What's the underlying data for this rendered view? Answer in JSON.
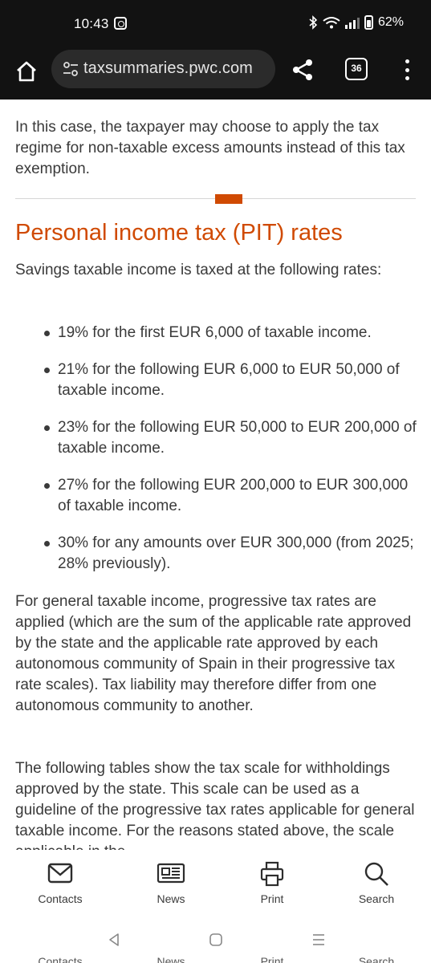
{
  "status_bar": {
    "time": "10:43",
    "battery": "62%"
  },
  "browser": {
    "url": "taxsummaries.pwc.com",
    "tab_count": "36"
  },
  "content": {
    "intro": "In this case, the taxpayer may choose to apply the tax regime for non-taxable excess amounts instead of this tax exemption.",
    "heading": "Personal income tax (PIT) rates",
    "savings_intro": "Savings taxable income is taxed at the following rates:",
    "rates": [
      "19% for the first EUR 6,000 of taxable income.",
      "21% for the following EUR 6,000 to EUR 50,000 of taxable income.",
      "23% for the following EUR 50,000 to EUR 200,000 of taxable income.",
      "27% for the following EUR 200,000 to EUR 300,000 of taxable income.",
      "30% for any amounts over EUR 300,000 (from 2025; 28% previously)."
    ],
    "general_para": "For general taxable income, progressive tax rates are applied (which are the sum of the applicable rate approved by the state and the applicable rate approved by each autonomous community of Spain in their progressive tax rate scales). Tax liability may therefore differ from one autonomous community to another.",
    "tables_para": "The following tables show the tax scale for withholdings approved by the state. This scale can be used as a guideline of the progressive tax rates applicable for general taxable income. For the reasons stated above, the scale applicable in the"
  },
  "bottom_nav": {
    "contacts": "Contacts",
    "news": "News",
    "print": "Print",
    "search": "Search"
  },
  "colors": {
    "accent": "#d04a02",
    "text": "#3a3a3a",
    "chrome": "#121212"
  }
}
